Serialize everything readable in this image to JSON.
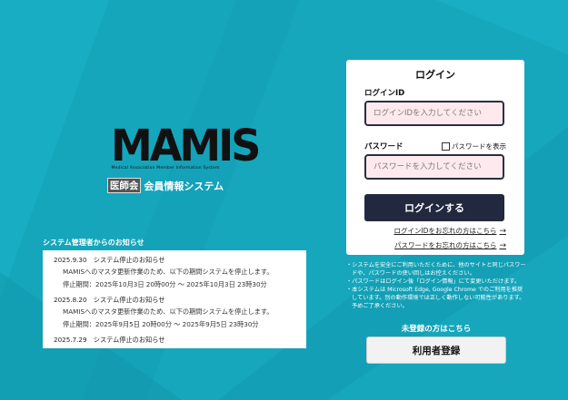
{
  "logo": {
    "mark": "MAMIS",
    "subtitle": "Medical Association Member Information System",
    "badge": "医師会",
    "system_name": "会員情報システム"
  },
  "notices": {
    "title": "システム管理者からのお知らせ",
    "items": [
      {
        "head": "2025.9.30　システム停止のお知らせ",
        "lines": [
          "MAMISへのマスタ更新作業のため、以下の期間システムを停止します。",
          "停止期間：2025年10月3日 20時00分 〜 2025年10月3日 23時30分"
        ]
      },
      {
        "head": "2025.8.20　システム停止のお知らせ",
        "lines": [
          "MAMISへのマスタ更新作業のため、以下の期間システムを停止します。",
          "停止期間：2025年9月5日 20時00分 〜 2025年9月5日 23時30分"
        ]
      },
      {
        "head": "2025.7.29　システム停止のお知らせ",
        "lines": []
      }
    ]
  },
  "login": {
    "title": "ログイン",
    "id_label": "ログインID",
    "id_placeholder": "ログインIDを入力してください",
    "password_label": "パスワード",
    "show_password_label": "パスワードを表示",
    "password_placeholder": "パスワードを入力してください",
    "submit_label": "ログインする",
    "forgot_id_link": "ログインIDをお忘れの方はこちら",
    "forgot_password_link": "パスワードをお忘れの方はこちら",
    "link_arrow": "→"
  },
  "notes": [
    "・システムを安全にご利用いただくために、他のサイトと同じパスワードや、パスワードの使い回しはお控えください。",
    "・パスワードはログイン後「ログイン情報」にて変更いただけます。",
    "・本システムは Microsoft Edge, Google Chrome でのご利用を推奨しています。別の動作環境では正しく動作しない可能性があります。予めご了承ください。"
  ],
  "register": {
    "prompt": "未登録の方はこちら",
    "button_label": "利用者登録"
  },
  "colors": {
    "background": "#16a7bd",
    "login_button": "#22293f",
    "input_fill": "#fde9ee"
  }
}
